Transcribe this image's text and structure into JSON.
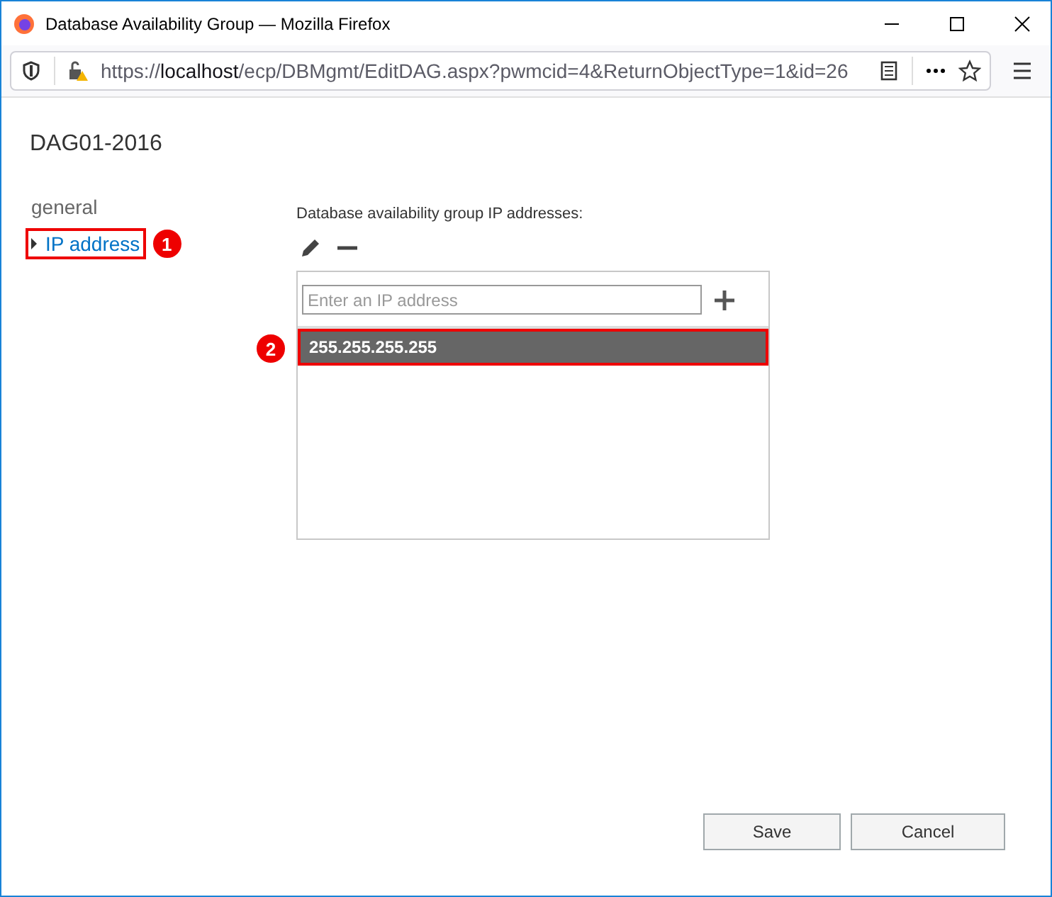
{
  "window": {
    "title": "Database Availability Group — Mozilla Firefox"
  },
  "address_bar": {
    "scheme": "https://",
    "host": "localhost",
    "path": "/ecp/DBMgmt/EditDAG.aspx?pwmcid=4&ReturnObjectType=1&id=26"
  },
  "page_title": "DAG01-2016",
  "nav": [
    {
      "label": "general",
      "selected": false
    },
    {
      "label": "IP address",
      "selected": true,
      "callout": "1"
    }
  ],
  "section_label": "Database availability group IP addresses:",
  "ip_input": {
    "placeholder": "Enter an IP address"
  },
  "ip_rows": [
    {
      "text": "255.255.255.255",
      "selected": true,
      "callout": "2"
    }
  ],
  "buttons": [
    {
      "label": "Save"
    },
    {
      "label": "Cancel"
    }
  ]
}
